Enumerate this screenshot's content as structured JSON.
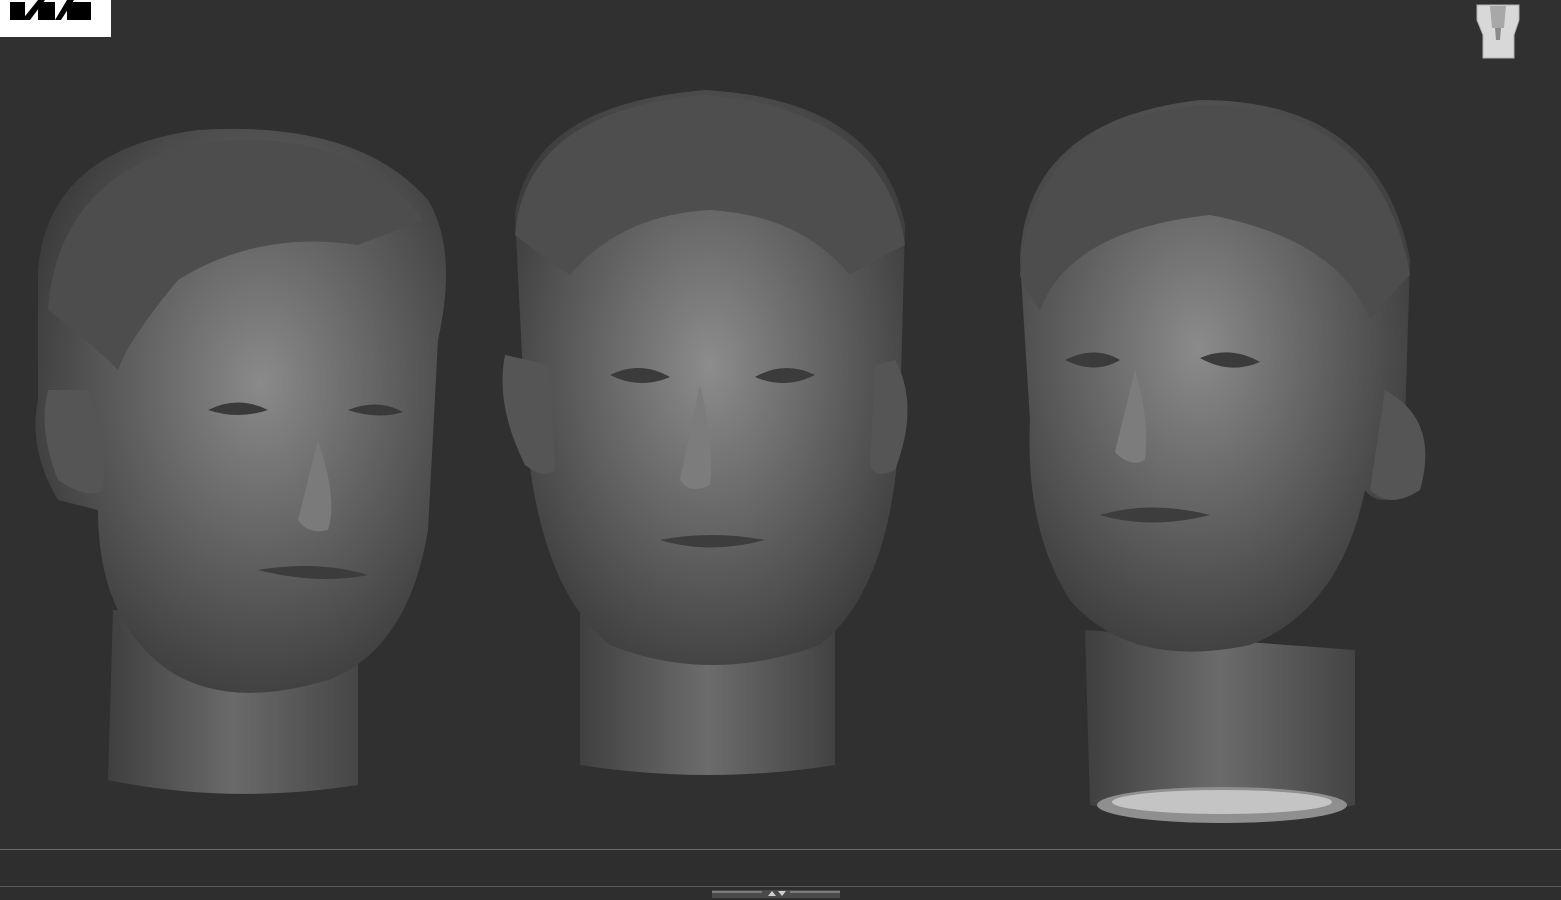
{
  "app": {
    "logo_icon": "zbrush-logo-icon",
    "navigation_icon": "navigation-cube-icon"
  },
  "viewport": {
    "background": "#303030",
    "models": [
      {
        "name": "head-three-quarter-left",
        "icon": "sculpt-head"
      },
      {
        "name": "head-front",
        "icon": "sculpt-head"
      },
      {
        "name": "head-three-quarter-right-tilted",
        "icon": "sculpt-head"
      }
    ]
  },
  "ui": {
    "splitter_icon": "splitter-arrows-icon"
  }
}
